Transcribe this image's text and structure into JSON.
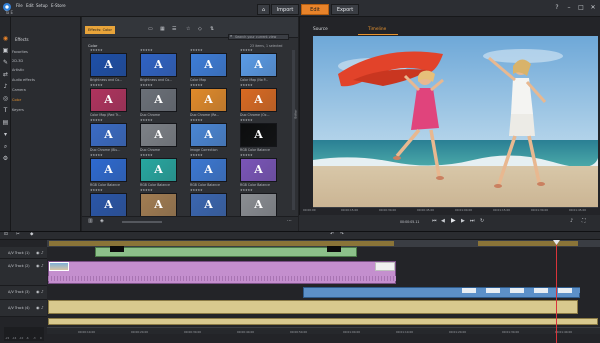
{
  "menu": [
    "File",
    "Edit",
    "Setup",
    "E-Store"
  ],
  "project_name": "Ta E",
  "nav": {
    "import": "Import",
    "edit": "Edit",
    "export": "Export"
  },
  "window_controls": [
    "?",
    "–",
    "□",
    "✕"
  ],
  "timecode_top": "00:00:31.11",
  "categories": {
    "header": "Effects",
    "items": [
      "Favorites",
      "2D-3D",
      "Artistic",
      "Audio effects",
      "Camera",
      "Color",
      "Keyers"
    ],
    "selected": "Color"
  },
  "library": {
    "tab": "Effects: Color",
    "breadcrumb": "Color",
    "count": "23 items, 1 selected",
    "search_placeholder": "Search your current view",
    "items": [
      {
        "label": "Brightness and Co...",
        "color": "#1d4fa8",
        "stars": "★★★★★"
      },
      {
        "label": "Brightness and Co...",
        "color": "#2f63c4",
        "stars": "★★★★★"
      },
      {
        "label": "Color Map",
        "color": "#3d7dd8",
        "stars": "★★★★★"
      },
      {
        "label": "Color Map (No P...",
        "color": "#5a9be6",
        "stars": "★★★★★"
      },
      {
        "label": "Color Map (Red Tr...",
        "color": "#b0335e",
        "stars": "★★★★★"
      },
      {
        "label": "Duo Chrome",
        "color": "#6b7078",
        "stars": "★★★★★"
      },
      {
        "label": "Duo Chrome (Re...",
        "color": "#e08a2a",
        "stars": "★★★★★"
      },
      {
        "label": "Duo Chrome (Oc...",
        "color": "#d96a22",
        "stars": "★★★★★"
      },
      {
        "label": "Duo Chrome (Blu...",
        "color": "#3a6bc4",
        "stars": "★★★★★"
      },
      {
        "label": "Duo Chrome",
        "color": "#7d8187",
        "stars": "★★★★★"
      },
      {
        "label": "Image Correction",
        "color": "#4a86d4",
        "stars": "★★★★★"
      },
      {
        "label": "RGB Color Balance",
        "color": "#0c0d0e",
        "stars": "★★★★★"
      },
      {
        "label": "RGB Color Balance",
        "color": "#2e6ad0",
        "stars": "★★★★★"
      },
      {
        "label": "RGB Color Balance",
        "color": "#27a7a0",
        "stars": "★★★★★"
      },
      {
        "label": "RGB Color Balance",
        "color": "#3c78d2",
        "stars": "★★★★★"
      },
      {
        "label": "RGB Color Balance",
        "color": "#7a55b8",
        "stars": "★★★★★"
      },
      {
        "label": "RGB Color Balance",
        "color": "#2a56a8",
        "stars": "★★★★★"
      },
      {
        "label": "RGB Color Balance",
        "color": "#a27d52",
        "stars": "★★★★★"
      },
      {
        "label": "RGB Color Balance",
        "color": "#3a66b0",
        "stars": "★★★★★"
      },
      {
        "label": "RGB Color Balance",
        "color": "#8a8d92",
        "stars": "★★★★★"
      }
    ]
  },
  "player": {
    "tabs": [
      "Source",
      "Timeline"
    ],
    "active_tab": "Timeline",
    "timecode": "00:00:05.11",
    "ruler": [
      "00:00:00",
      "00:00:15.00",
      "00:00:30.00",
      "00:00:45.00",
      "00:01:00.00",
      "00:01:15.00",
      "00:01:30.00",
      "00:01:45.00"
    ],
    "side_tab": "Editor"
  },
  "timeline": {
    "tracks": [
      {
        "name": "A/V Track (1)"
      },
      {
        "name": "A/V Track (2)"
      },
      {
        "name": "A/V Track (3)"
      },
      {
        "name": "A/V Track (4)"
      }
    ],
    "audio_scale": [
      "-22",
      "-16",
      "-10",
      "-6",
      "-3",
      "0"
    ],
    "ruler": [
      "00:00:10.00",
      "00:00:20.00",
      "00:00:30.00",
      "00:00:40.00",
      "00:00:50.00",
      "00:01:00.00",
      "00:01:10.00",
      "00:01:20.00",
      "00:01:30.00",
      "00:01:40.00"
    ]
  },
  "colors": {
    "accent": "#e8832a",
    "clip_purple": "#c48fce",
    "clip_tan": "#d8c98e",
    "clip_green": "#8cc08a",
    "clip_blue": "#5c90c8",
    "playhead": "#d9343a"
  }
}
